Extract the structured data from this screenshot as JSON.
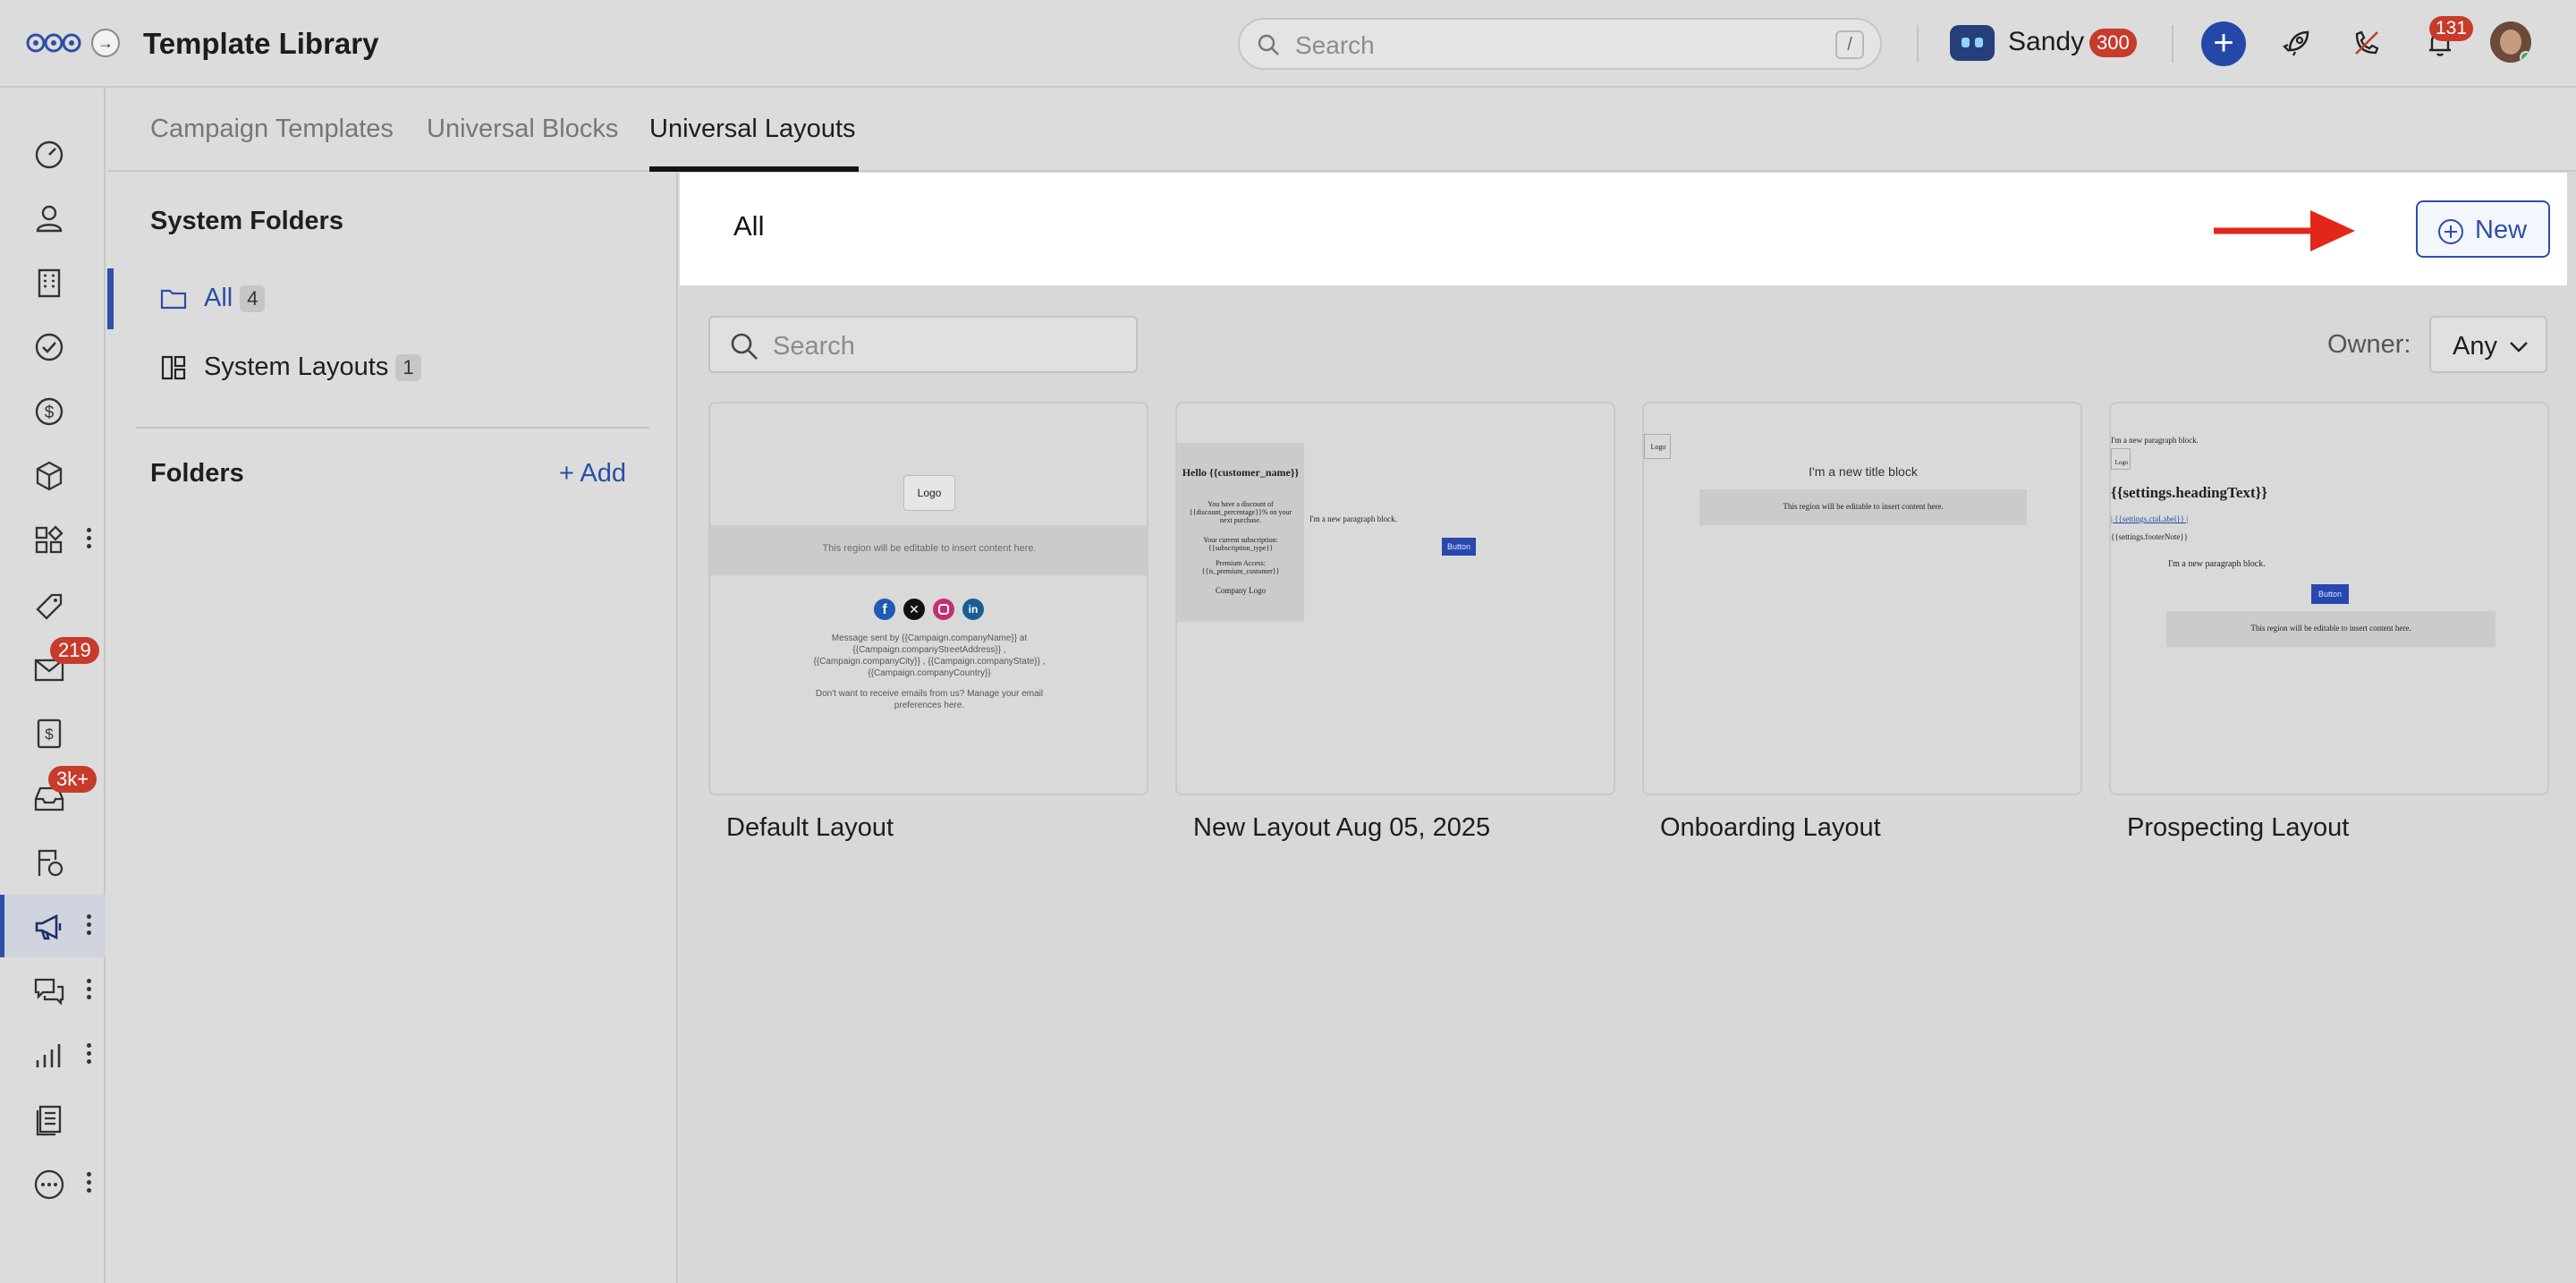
{
  "app": {
    "title": "Template Library"
  },
  "topbar": {
    "search_placeholder": "Search",
    "search_shortcut": "/",
    "user_name": "Sandy",
    "user_points": "300",
    "notifications_count": "131",
    "icons": [
      "logo-icon",
      "collapse-icon",
      "search-icon",
      "assistant-bot-icon",
      "plus-icon",
      "rocket-icon",
      "phone-off-icon",
      "bell-icon",
      "avatar"
    ]
  },
  "rail": {
    "items": [
      {
        "name": "dashboard-icon"
      },
      {
        "name": "contacts-icon"
      },
      {
        "name": "companies-icon"
      },
      {
        "name": "tasks-icon"
      },
      {
        "name": "deals-icon"
      },
      {
        "name": "products-icon"
      },
      {
        "name": "apps-icon"
      },
      {
        "name": "tags-icon"
      },
      {
        "name": "mail-icon",
        "badge": "219"
      },
      {
        "name": "quotes-icon"
      },
      {
        "name": "inbox-icon",
        "badge": "3k+"
      },
      {
        "name": "sequences-icon"
      },
      {
        "name": "campaigns-icon"
      },
      {
        "name": "conversations-icon"
      },
      {
        "name": "reports-icon"
      },
      {
        "name": "documents-icon"
      },
      {
        "name": "more-icon"
      }
    ]
  },
  "tabs": [
    {
      "label": "Campaign Templates"
    },
    {
      "label": "Universal Blocks"
    },
    {
      "label": "Universal Layouts",
      "active": true
    }
  ],
  "sidebar": {
    "system_heading": "System Folders",
    "all_label": "All",
    "all_count": "4",
    "system_layouts_label": "System Layouts",
    "system_layouts_count": "1",
    "folders_heading": "Folders",
    "add_label": "Add"
  },
  "content": {
    "header_title": "All",
    "new_button": "New",
    "search_placeholder": "Search",
    "owner_label": "Owner:",
    "owner_value": "Any"
  },
  "layouts": [
    {
      "title": "Default Layout",
      "preview": {
        "logo": "Logo",
        "region": "This region will be editable to insert content here.",
        "footer_1": "Message sent by {{Campaign.companyName}} at {{Campaign.companyStreetAddress}} , {{Campaign.companyCity}} , {{Campaign.companyState}} , {{Campaign.companyCountry}}",
        "footer_2": "Don't want to receive emails from us? Manage your email preferences here."
      }
    },
    {
      "title": "New Layout Aug 05, 2025",
      "preview": {
        "hello": "Hello {{customer_name}}",
        "discount": "You have a discount of {{discount_percentage}}% on your next purchase.",
        "subscription": "Your current subscription: {{subscription_type}}",
        "premium": "Premium Access: {{is_premium_customer}}",
        "company_logo": "Company Logo",
        "paragraph": "I'm a new paragraph block.",
        "button": "Button"
      }
    },
    {
      "title": "Onboarding Layout",
      "preview": {
        "logo": "Logo",
        "title_block": "I'm a new title block",
        "region": "This region will be editable to insert content here."
      }
    },
    {
      "title": "Prospecting Layout",
      "preview": {
        "paragraph_top": "I'm a new paragraph block.",
        "logo": "Logo",
        "heading": "{{settings.headingText}}",
        "cta": "| {{settings.ctaLabel}} |",
        "footer_note": "{{settings.footerNote}}",
        "paragraph": "I'm a new paragraph block.",
        "button": "Button",
        "region": "This region will be editable to insert content here."
      }
    }
  ],
  "colors": {
    "accent": "#2e4fa8",
    "badge": "#c63b2b",
    "arrow": "#e3261a"
  }
}
